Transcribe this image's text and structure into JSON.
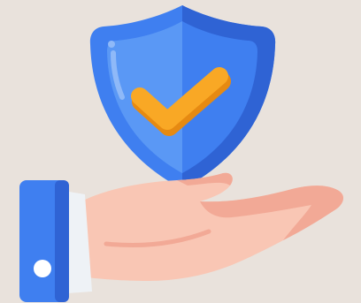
{
  "illustration": {
    "subject": "hand-holding-shield-icon",
    "elements": [
      "shield-icon",
      "checkmark-icon",
      "open-hand-icon",
      "sleeve-cuff-icon",
      "cuff-button-icon"
    ]
  },
  "colors": {
    "background": "#e9e2dc",
    "shield_main": "#3f7ff0",
    "shield_light": "#5a98f5",
    "shield_dark": "#2f63d4",
    "check_main": "#f9a825",
    "check_shadow": "#e68a12",
    "skin": "#f9c6b4",
    "skin_shadow": "#f2a996",
    "sleeve": "#3f7ff0",
    "cuff": "#eef2f6",
    "button": "#ffffff"
  }
}
